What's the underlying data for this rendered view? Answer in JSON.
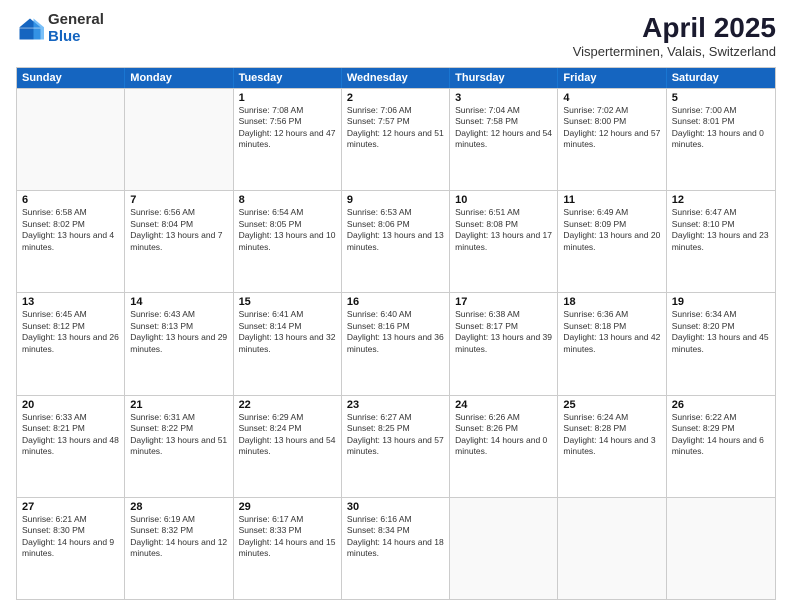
{
  "header": {
    "logo": {
      "general": "General",
      "blue": "Blue"
    },
    "title": "April 2025",
    "subtitle": "Visperterminen, Valais, Switzerland"
  },
  "days_of_week": [
    "Sunday",
    "Monday",
    "Tuesday",
    "Wednesday",
    "Thursday",
    "Friday",
    "Saturday"
  ],
  "weeks": [
    [
      {
        "day": "",
        "info": ""
      },
      {
        "day": "",
        "info": ""
      },
      {
        "day": "1",
        "info": "Sunrise: 7:08 AM\nSunset: 7:56 PM\nDaylight: 12 hours and 47 minutes."
      },
      {
        "day": "2",
        "info": "Sunrise: 7:06 AM\nSunset: 7:57 PM\nDaylight: 12 hours and 51 minutes."
      },
      {
        "day": "3",
        "info": "Sunrise: 7:04 AM\nSunset: 7:58 PM\nDaylight: 12 hours and 54 minutes."
      },
      {
        "day": "4",
        "info": "Sunrise: 7:02 AM\nSunset: 8:00 PM\nDaylight: 12 hours and 57 minutes."
      },
      {
        "day": "5",
        "info": "Sunrise: 7:00 AM\nSunset: 8:01 PM\nDaylight: 13 hours and 0 minutes."
      }
    ],
    [
      {
        "day": "6",
        "info": "Sunrise: 6:58 AM\nSunset: 8:02 PM\nDaylight: 13 hours and 4 minutes."
      },
      {
        "day": "7",
        "info": "Sunrise: 6:56 AM\nSunset: 8:04 PM\nDaylight: 13 hours and 7 minutes."
      },
      {
        "day": "8",
        "info": "Sunrise: 6:54 AM\nSunset: 8:05 PM\nDaylight: 13 hours and 10 minutes."
      },
      {
        "day": "9",
        "info": "Sunrise: 6:53 AM\nSunset: 8:06 PM\nDaylight: 13 hours and 13 minutes."
      },
      {
        "day": "10",
        "info": "Sunrise: 6:51 AM\nSunset: 8:08 PM\nDaylight: 13 hours and 17 minutes."
      },
      {
        "day": "11",
        "info": "Sunrise: 6:49 AM\nSunset: 8:09 PM\nDaylight: 13 hours and 20 minutes."
      },
      {
        "day": "12",
        "info": "Sunrise: 6:47 AM\nSunset: 8:10 PM\nDaylight: 13 hours and 23 minutes."
      }
    ],
    [
      {
        "day": "13",
        "info": "Sunrise: 6:45 AM\nSunset: 8:12 PM\nDaylight: 13 hours and 26 minutes."
      },
      {
        "day": "14",
        "info": "Sunrise: 6:43 AM\nSunset: 8:13 PM\nDaylight: 13 hours and 29 minutes."
      },
      {
        "day": "15",
        "info": "Sunrise: 6:41 AM\nSunset: 8:14 PM\nDaylight: 13 hours and 32 minutes."
      },
      {
        "day": "16",
        "info": "Sunrise: 6:40 AM\nSunset: 8:16 PM\nDaylight: 13 hours and 36 minutes."
      },
      {
        "day": "17",
        "info": "Sunrise: 6:38 AM\nSunset: 8:17 PM\nDaylight: 13 hours and 39 minutes."
      },
      {
        "day": "18",
        "info": "Sunrise: 6:36 AM\nSunset: 8:18 PM\nDaylight: 13 hours and 42 minutes."
      },
      {
        "day": "19",
        "info": "Sunrise: 6:34 AM\nSunset: 8:20 PM\nDaylight: 13 hours and 45 minutes."
      }
    ],
    [
      {
        "day": "20",
        "info": "Sunrise: 6:33 AM\nSunset: 8:21 PM\nDaylight: 13 hours and 48 minutes."
      },
      {
        "day": "21",
        "info": "Sunrise: 6:31 AM\nSunset: 8:22 PM\nDaylight: 13 hours and 51 minutes."
      },
      {
        "day": "22",
        "info": "Sunrise: 6:29 AM\nSunset: 8:24 PM\nDaylight: 13 hours and 54 minutes."
      },
      {
        "day": "23",
        "info": "Sunrise: 6:27 AM\nSunset: 8:25 PM\nDaylight: 13 hours and 57 minutes."
      },
      {
        "day": "24",
        "info": "Sunrise: 6:26 AM\nSunset: 8:26 PM\nDaylight: 14 hours and 0 minutes."
      },
      {
        "day": "25",
        "info": "Sunrise: 6:24 AM\nSunset: 8:28 PM\nDaylight: 14 hours and 3 minutes."
      },
      {
        "day": "26",
        "info": "Sunrise: 6:22 AM\nSunset: 8:29 PM\nDaylight: 14 hours and 6 minutes."
      }
    ],
    [
      {
        "day": "27",
        "info": "Sunrise: 6:21 AM\nSunset: 8:30 PM\nDaylight: 14 hours and 9 minutes."
      },
      {
        "day": "28",
        "info": "Sunrise: 6:19 AM\nSunset: 8:32 PM\nDaylight: 14 hours and 12 minutes."
      },
      {
        "day": "29",
        "info": "Sunrise: 6:17 AM\nSunset: 8:33 PM\nDaylight: 14 hours and 15 minutes."
      },
      {
        "day": "30",
        "info": "Sunrise: 6:16 AM\nSunset: 8:34 PM\nDaylight: 14 hours and 18 minutes."
      },
      {
        "day": "",
        "info": ""
      },
      {
        "day": "",
        "info": ""
      },
      {
        "day": "",
        "info": ""
      }
    ]
  ]
}
